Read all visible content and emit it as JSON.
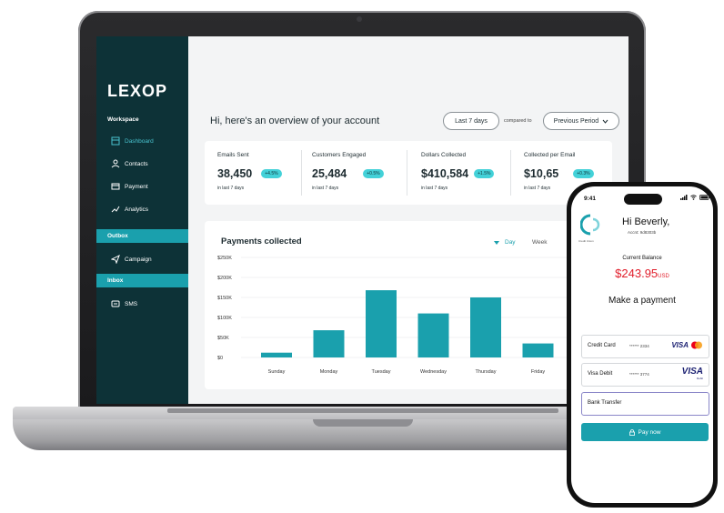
{
  "sidebar": {
    "logo": "LEXOP",
    "workspace_label": "Workspace",
    "workspace_items": [
      "Dashboard",
      "Contacts",
      "Payment",
      "Analytics"
    ],
    "outbox_label": "Outbox",
    "outbox_items": [
      "Campaign"
    ],
    "inbox_label": "Inbox",
    "inbox_items": [
      "SMS"
    ]
  },
  "header": {
    "greeting": "Hi, here's an overview of your account",
    "range_button": "Last 7 days",
    "compared_to": "compared to",
    "period_dropdown": "Previous Period"
  },
  "stats": [
    {
      "label": "Emails Sent",
      "value": "38,450",
      "change": "+4.5%",
      "sub": "in last 7 days"
    },
    {
      "label": "Customers Engaged",
      "value": "25,484",
      "change": "+0.5%",
      "sub": "in last 7 days"
    },
    {
      "label": "Dollars Collected",
      "value": "$410,584",
      "change": "+1.5%",
      "sub": "in last 7 days"
    },
    {
      "label": "Collected per Email",
      "value": "$10,65",
      "change": "+0.3%",
      "sub": "in last 7 days"
    }
  ],
  "chart_card": {
    "title": "Payments collected",
    "tabs": [
      "Day",
      "Week"
    ]
  },
  "chart_data": {
    "type": "bar",
    "title": "Payments collected",
    "categories": [
      "Sunday",
      "Monday",
      "Tuesday",
      "Wednesday",
      "Thursday",
      "Friday"
    ],
    "values": [
      12000,
      68000,
      168000,
      110000,
      150000,
      35000
    ],
    "yticks": [
      "$250K",
      "$200K",
      "$150K",
      "$100K",
      "$50K",
      "$0"
    ],
    "ylim": [
      0,
      250000
    ],
    "grid": true,
    "bar_color": "#1aa0ad"
  },
  "phone": {
    "time": "9:41",
    "brand": "Credit Union",
    "greeting": "Hi Beverly,",
    "account": "Accnt: 9d8303b",
    "balance_label": "Current Balance",
    "balance_value": "$243.95",
    "balance_currency": "USD",
    "section_title": "Make a payment",
    "methods": [
      {
        "name": "Credit Card",
        "mask": "****** 2334",
        "logo": "VISA"
      },
      {
        "name": "Visa Debit",
        "mask": "****** 3774",
        "logo": "VISA",
        "logo_sub": "Debit"
      },
      {
        "name": "Bank Transfer",
        "mask": "",
        "logo": ""
      }
    ],
    "pay_button": "Pay now"
  },
  "colors": {
    "sidebar_bg": "#0d3237",
    "accent": "#1aa0ad",
    "badge": "#43d1d8",
    "balance_red": "#e11d2a"
  }
}
